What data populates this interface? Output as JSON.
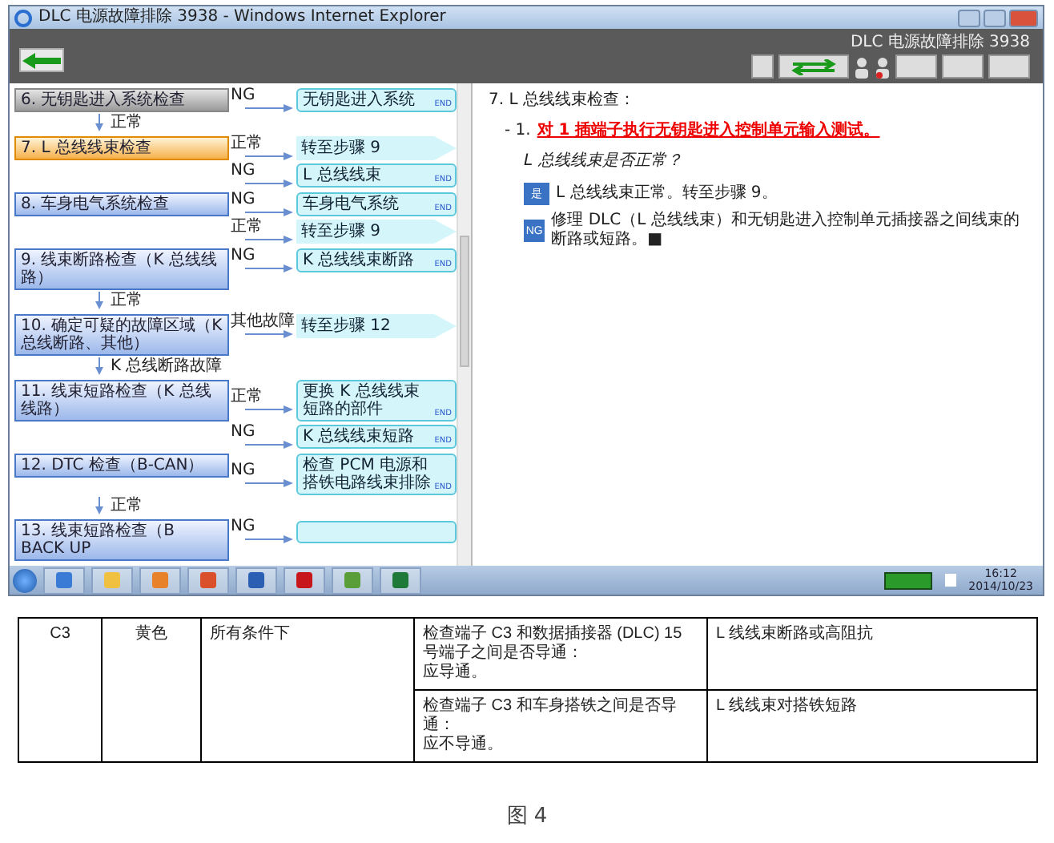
{
  "window": {
    "title": "DLC 电源故障排除 3938 - Windows Internet Explorer"
  },
  "toolbar": {
    "page_title": "DLC 电源故障排除 3938"
  },
  "flowchart": {
    "steps": [
      {
        "label": "6. 无钥匙进入系统检查",
        "selected": false,
        "visited": true,
        "next_label": "正常",
        "results": [
          {
            "branch": "NG",
            "kind": "end",
            "text": "无钥匙进入系统",
            "badge": "END"
          }
        ]
      },
      {
        "label": "7. L 总线线束检查",
        "selected": true,
        "visited": false,
        "results": [
          {
            "branch": "正常",
            "kind": "goto",
            "text": "转至步骤 9"
          },
          {
            "branch": "NG",
            "kind": "end",
            "text": "L 总线线束",
            "badge": "END"
          }
        ]
      },
      {
        "label": "8. 车身电气系统检查",
        "selected": false,
        "visited": false,
        "results": [
          {
            "branch": "NG",
            "kind": "end",
            "text": "车身电气系统",
            "badge": "END"
          },
          {
            "branch": "正常",
            "kind": "goto",
            "text": "转至步骤 9"
          }
        ]
      },
      {
        "label": "9. 线束断路检查（K 总线线路）",
        "selected": false,
        "visited": false,
        "next_label": "正常",
        "results": [
          {
            "branch": "NG",
            "kind": "end",
            "text": "K 总线线束断路",
            "badge": "END"
          }
        ]
      },
      {
        "label": "10. 确定可疑的故障区域（K 总线断路、其他）",
        "selected": false,
        "visited": false,
        "next_label": "K 总线断路故障",
        "results": [
          {
            "branch": "其他故障",
            "kind": "goto",
            "text": "转至步骤 12"
          }
        ]
      },
      {
        "label": "11. 线束短路检查（K 总线线路）",
        "selected": false,
        "visited": false,
        "results": [
          {
            "branch": "正常",
            "kind": "end",
            "text": "更换 K 总线线束短路的部件",
            "badge": "END"
          },
          {
            "branch": "NG",
            "kind": "end",
            "text": "K 总线线束短路",
            "badge": "END"
          }
        ]
      },
      {
        "label": "12. DTC 检查（B-CAN）",
        "selected": false,
        "visited": false,
        "next_label": "正常",
        "results": [
          {
            "branch": "NG",
            "kind": "end",
            "text": "检查 PCM 电源和搭铁电路线束排除",
            "badge": "END"
          }
        ]
      },
      {
        "label": "13. 线束短路检查（B BACK UP",
        "selected": false,
        "visited": false,
        "results": [
          {
            "branch": "NG",
            "kind": "end"
          }
        ]
      }
    ]
  },
  "detail": {
    "heading": "7. L 总线线束检查：",
    "instruction": {
      "marker": "- 1.",
      "text": "对 1 插端子执行无钥匙进入控制单元输入测试。"
    },
    "question": "L 总线线束是否正常？",
    "answers": [
      {
        "badge": "是",
        "text": "L 总线线束正常。转至步骤 9。"
      },
      {
        "badge": "NG",
        "text": "修理 DLC（L 总线线束）和无钥匙进入控制单元插接器之间线束的断路或短路。■"
      }
    ]
  },
  "taskbar": {
    "time": "16:12",
    "date": "2014/10/23"
  },
  "table": {
    "terminal": "C3",
    "wire_color": "黄色",
    "condition": "所有条件下",
    "checks": [
      {
        "test": [
          "检查端子 C3 和数据插接器 (DLC) 15 号端子之间是否导通：",
          "应导通。"
        ],
        "fault": "L 线线束断路或高阻抗"
      },
      {
        "test": [
          "检查端子 C3 和车身搭铁之间是否导通：",
          "应不导通。"
        ],
        "fault": "L 线线束对搭铁短路"
      }
    ]
  },
  "caption": "图 4"
}
